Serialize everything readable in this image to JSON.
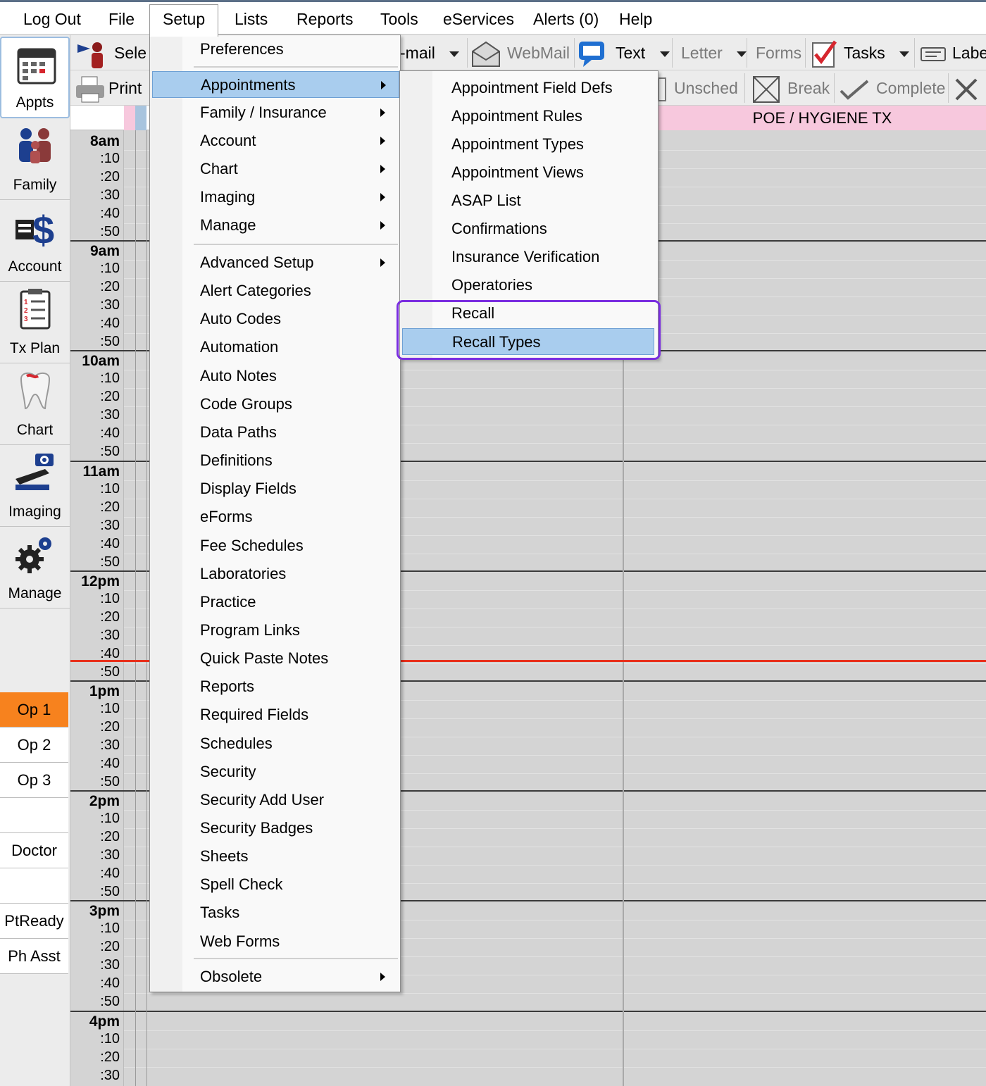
{
  "menubar": [
    "Log Out",
    "File",
    "Setup",
    "Lists",
    "Reports",
    "Tools",
    "eServices",
    "Alerts (0)",
    "Help"
  ],
  "toolbar1": {
    "select": "Sele",
    "email": "-mail",
    "webmail": "WebMail",
    "text": "Text",
    "letter": "Letter",
    "forms": "Forms",
    "tasks": "Tasks",
    "label": "Labe"
  },
  "toolbar2": {
    "print": "Print",
    "unsched": "Unsched",
    "break": "Break",
    "complete": "Complete"
  },
  "modules": [
    "Appts",
    "Family",
    "Account",
    "Tx Plan",
    "Chart",
    "Imaging",
    "Manage"
  ],
  "schedule": {
    "hours": [
      "8am",
      "9am",
      "10am",
      "11am",
      "12pm",
      "1pm",
      "2pm",
      "3pm",
      "4pm"
    ],
    "minutes": [
      ":10",
      ":20",
      ":30",
      ":40",
      ":50"
    ],
    "op_header": "POE / HYGIENE TX"
  },
  "op_list": [
    "Op 1",
    "Op 2",
    "Op 3",
    "",
    "Doctor",
    "",
    "PtReady",
    "Ph Asst"
  ],
  "setup_menu": {
    "top": "Preferences",
    "group1": [
      "Appointments",
      "Family / Insurance",
      "Account",
      "Chart",
      "Imaging",
      "Manage"
    ],
    "group2": [
      "Advanced Setup",
      "Alert Categories",
      "Auto Codes",
      "Automation",
      "Auto Notes",
      "Code Groups",
      "Data Paths",
      "Definitions",
      "Display Fields",
      "eForms",
      "Fee Schedules",
      "Laboratories",
      "Practice",
      "Program Links",
      "Quick Paste Notes",
      "Reports",
      "Required Fields",
      "Schedules",
      "Security",
      "Security Add User",
      "Security Badges",
      "Sheets",
      "Spell Check",
      "Tasks",
      "Web Forms"
    ],
    "bottom": "Obsolete"
  },
  "appointments_submenu": [
    "Appointment Field Defs",
    "Appointment Rules",
    "Appointment Types",
    "Appointment Views",
    "ASAP List",
    "Confirmations",
    "Insurance Verification",
    "Operatories",
    "Recall",
    "Recall Types"
  ],
  "colors": {
    "highlight_border": "#7a2de0",
    "menu_hover": "#a9cdee",
    "op_active": "#f7821e",
    "now_line": "#e8301c",
    "op_header": "#f7c8dd"
  }
}
